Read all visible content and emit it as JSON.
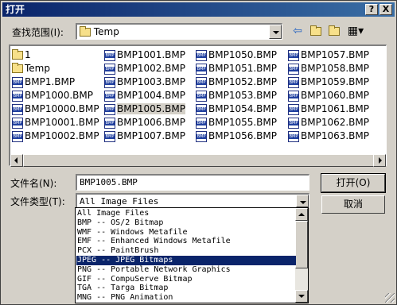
{
  "window": {
    "title": "打开",
    "help_label": "?",
    "close_label": "X"
  },
  "look_in": {
    "label": "查找范围(I):",
    "value": "Temp"
  },
  "files": [
    {
      "name": "1",
      "type": "folder"
    },
    {
      "name": "Temp",
      "type": "folder"
    },
    {
      "name": "BMP1.BMP",
      "type": "bmp"
    },
    {
      "name": "BMP1000.BMP",
      "type": "bmp"
    },
    {
      "name": "BMP10000.BMP",
      "type": "bmp"
    },
    {
      "name": "BMP10001.BMP",
      "type": "bmp"
    },
    {
      "name": "BMP10002.BMP",
      "type": "bmp"
    },
    {
      "name": "BMP1001.BMP",
      "type": "bmp"
    },
    {
      "name": "BMP1002.BMP",
      "type": "bmp"
    },
    {
      "name": "BMP1003.BMP",
      "type": "bmp"
    },
    {
      "name": "BMP1004.BMP",
      "type": "bmp"
    },
    {
      "name": "BMP1005.BMP",
      "type": "bmp",
      "selected": true
    },
    {
      "name": "BMP1006.BMP",
      "type": "bmp"
    },
    {
      "name": "BMP1007.BMP",
      "type": "bmp"
    },
    {
      "name": "BMP1050.BMP",
      "type": "bmp"
    },
    {
      "name": "BMP1051.BMP",
      "type": "bmp"
    },
    {
      "name": "BMP1052.BMP",
      "type": "bmp"
    },
    {
      "name": "BMP1053.BMP",
      "type": "bmp"
    },
    {
      "name": "BMP1054.BMP",
      "type": "bmp"
    },
    {
      "name": "BMP1055.BMP",
      "type": "bmp"
    },
    {
      "name": "BMP1056.BMP",
      "type": "bmp"
    },
    {
      "name": "BMP1057.BMP",
      "type": "bmp"
    },
    {
      "name": "BMP1058.BMP",
      "type": "bmp"
    },
    {
      "name": "BMP1059.BMP",
      "type": "bmp"
    },
    {
      "name": "BMP1060.BMP",
      "type": "bmp"
    },
    {
      "name": "BMP1061.BMP",
      "type": "bmp"
    },
    {
      "name": "BMP1062.BMP",
      "type": "bmp"
    },
    {
      "name": "BMP1063.BMP",
      "type": "bmp"
    }
  ],
  "filename": {
    "label": "文件名(N):",
    "value": "BMP1005.BMP"
  },
  "filetype": {
    "label": "文件类型(T):",
    "value": "All Image Files"
  },
  "buttons": {
    "open": "打开(O)",
    "cancel": "取消"
  },
  "filetype_options": [
    "All Image Files",
    "BMP -- OS/2 Bitmap",
    "WMF -- Windows Metafile",
    "EMF -- Enhanced Windows Metafile",
    "PCX -- PaintBrush",
    "JPEG -- JPEG Bitmaps",
    "PNG -- Portable Network Graphics",
    "GIF -- CompuServe Bitmap",
    "TGA -- Targa Bitmap",
    "MNG -- PNG Animation"
  ],
  "filetype_selected_index": 5,
  "icons": [
    "back-icon",
    "up-folder-icon",
    "new-folder-icon",
    "view-menu-icon",
    "folder-icon",
    "bmp-file-icon"
  ]
}
